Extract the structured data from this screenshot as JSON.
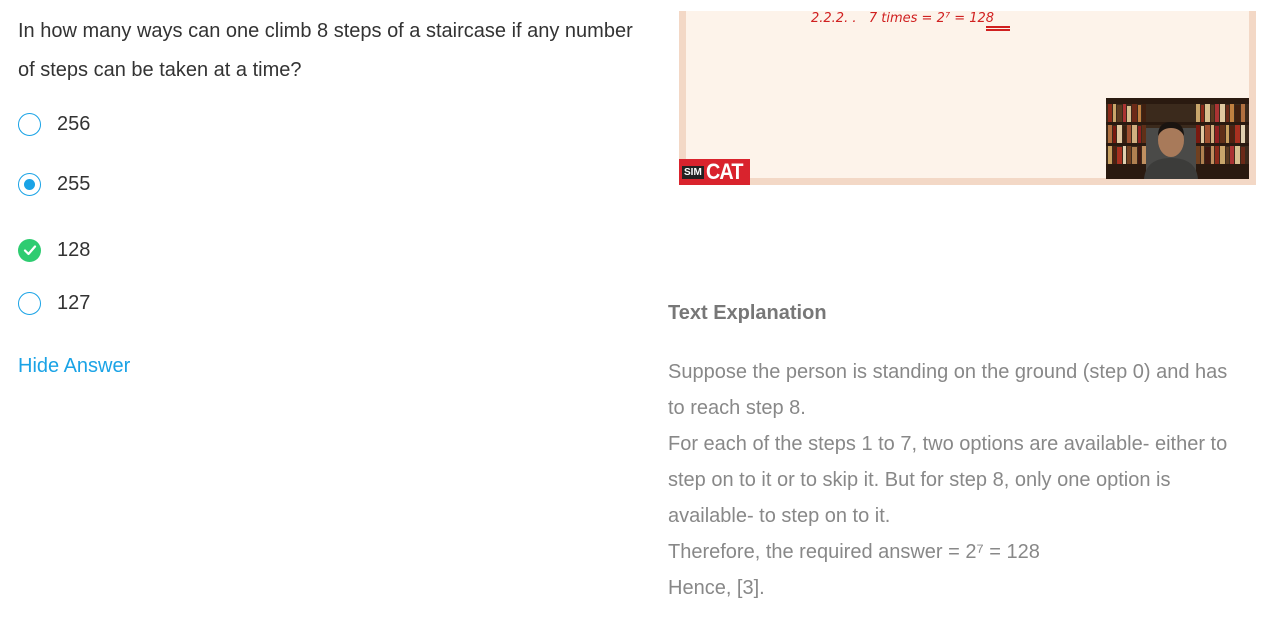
{
  "question": {
    "text": "In how many ways can one climb 8 steps of a staircase if any number of steps can be taken at a time?"
  },
  "options": [
    {
      "label": "256",
      "state": "unselected"
    },
    {
      "label": "255",
      "state": "selected"
    },
    {
      "label": "128",
      "state": "correct"
    },
    {
      "label": "127",
      "state": "unselected"
    }
  ],
  "hide_answer_label": "Hide Answer",
  "video": {
    "annotation": "2.2.2. .   7 times = 2⁷ = 128",
    "logo_prefix": "SIM",
    "logo_main": "CAT"
  },
  "explanation": {
    "title": "Text Explanation",
    "lines": [
      "Suppose the person is standing on the ground (step 0) and has",
      "to reach step 8.",
      "For each of the steps 1 to 7, two options are available- either to",
      "step on to it or to skip it. But for step 8, only one option is",
      "available- to step on to it.",
      "Therefore, the required answer = 2⁷ = 128",
      "Hence, [3]."
    ]
  },
  "colors": {
    "accent": "#1aa3e6",
    "correct": "#2ecc71",
    "logo_red": "#d9232d",
    "annotation_red": "#d02020"
  },
  "icons": {
    "correct": "checkmark-icon",
    "selected": "radio-selected-icon",
    "unselected": "radio-empty-icon"
  }
}
